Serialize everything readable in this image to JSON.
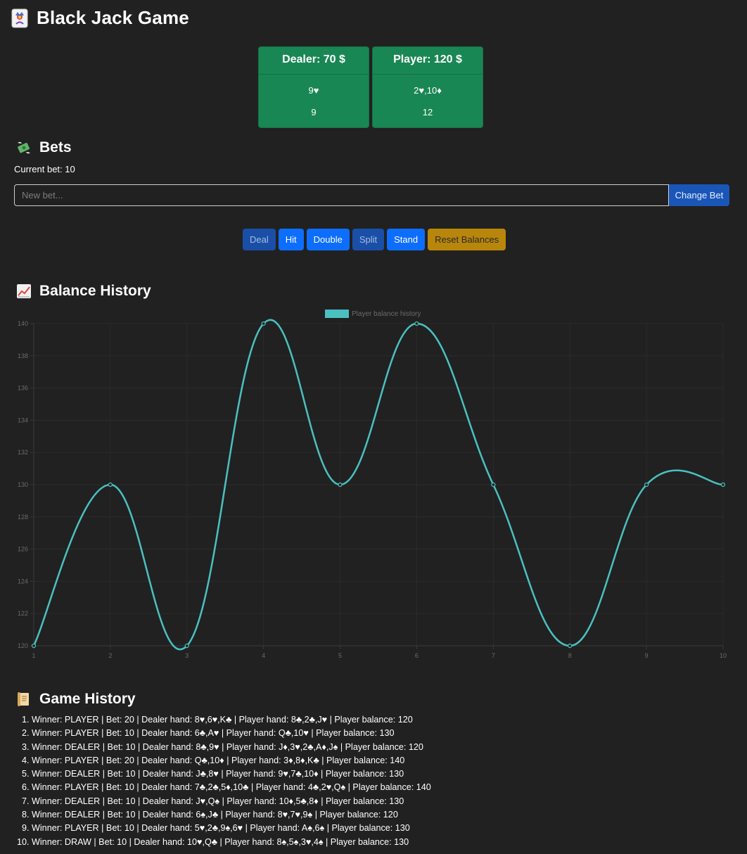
{
  "header": {
    "title": "Black Jack Game",
    "icon": "joker-card-icon"
  },
  "dealer": {
    "title": "Dealer: 70 $",
    "cards": "9♥",
    "score": "9"
  },
  "player": {
    "title": "Player: 120 $",
    "cards": "2♥,10♦",
    "score": "12"
  },
  "bets": {
    "title": "Bets",
    "icon": "money-wings-icon",
    "current_bet": "Current bet: 10",
    "input_placeholder": "New bet...",
    "change_button": "Change Bet"
  },
  "controls": {
    "deal": "Deal",
    "hit": "Hit",
    "double": "Double",
    "split": "Split",
    "stand": "Stand",
    "reset": "Reset Balances"
  },
  "balance_history": {
    "title": "Balance History",
    "icon": "chart-increasing-icon"
  },
  "chart_data": {
    "type": "line",
    "legend_position": "top-center",
    "series": [
      {
        "name": "Player balance history",
        "color": "#4bc0c0",
        "x": [
          1,
          2,
          3,
          4,
          5,
          6,
          7,
          8,
          9,
          10
        ],
        "values": [
          120,
          130,
          120,
          140,
          130,
          140,
          130,
          120,
          130,
          130
        ]
      }
    ],
    "x_ticks": [
      "1",
      "2",
      "3",
      "4",
      "5",
      "6",
      "7",
      "8",
      "9",
      "10"
    ],
    "y_ticks": [
      "120",
      "122",
      "124",
      "126",
      "128",
      "130",
      "132",
      "134",
      "136",
      "138",
      "140"
    ],
    "ylim": [
      120,
      140
    ],
    "grid": true
  },
  "game_history": {
    "title": "Game History",
    "icon": "scroll-icon",
    "entries": [
      "Winner: PLAYER | Bet: 20 | Dealer hand: 8♥,6♥,K♣ | Player hand: 8♣,2♣,J♥ | Player balance: 120",
      "Winner: PLAYER | Bet: 10 | Dealer hand: 6♣,A♥ | Player hand: Q♣,10♥ | Player balance: 130",
      "Winner: DEALER | Bet: 10 | Dealer hand: 8♣,9♥ | Player hand: J♦,3♥,2♣,A♦,J♠ | Player balance: 120",
      "Winner: PLAYER | Bet: 20 | Dealer hand: Q♣,10♦ | Player hand: 3♦,8♦,K♣ | Player balance: 140",
      "Winner: DEALER | Bet: 10 | Dealer hand: J♣,8♥ | Player hand: 9♥,7♣,10♦ | Player balance: 130",
      "Winner: PLAYER | Bet: 10 | Dealer hand: 7♣,2♣,5♦,10♣ | Player hand: 4♣,2♥,Q♠ | Player balance: 140",
      "Winner: DEALER | Bet: 10 | Dealer hand: J♥,Q♠ | Player hand: 10♦,5♣,8♦ | Player balance: 130",
      "Winner: DEALER | Bet: 10 | Dealer hand: 6♠,J♣ | Player hand: 8♥,7♥,9♠ | Player balance: 120",
      "Winner: PLAYER | Bet: 10 | Dealer hand: 5♥,2♣,9♠,6♥ | Player hand: A♠,6♠ | Player balance: 130",
      "Winner: DRAW | Bet: 10 | Dealer hand: 10♥,Q♣ | Player hand: 8♠,5♠,3♥,4♠ | Player balance: 130"
    ]
  }
}
